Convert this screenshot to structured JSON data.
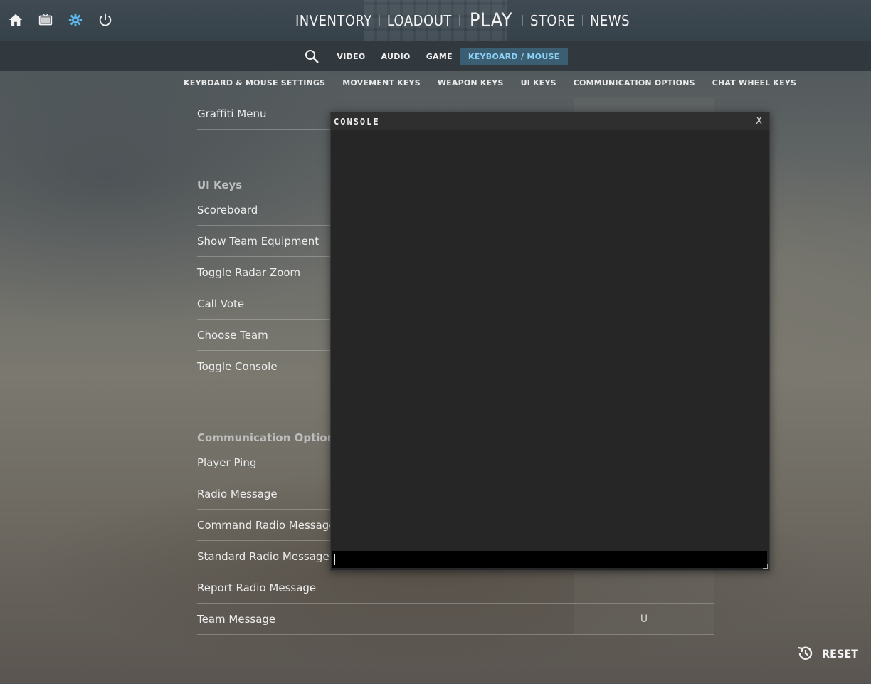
{
  "top_icons": [
    {
      "name": "home-icon"
    },
    {
      "name": "tv-icon"
    },
    {
      "name": "settings-icon"
    },
    {
      "name": "power-icon"
    }
  ],
  "main_nav": {
    "inventory": "INVENTORY",
    "loadout": "LOADOUT",
    "play": "PLAY",
    "store": "STORE",
    "news": "NEWS"
  },
  "settings_tabs": {
    "video": "VIDEO",
    "audio": "AUDIO",
    "game": "GAME",
    "keyboard_mouse": "KEYBOARD / MOUSE",
    "active": "KEYBOARD / MOUSE"
  },
  "categories": [
    "KEYBOARD & MOUSE SETTINGS",
    "MOVEMENT KEYS",
    "WEAPON KEYS",
    "UI KEYS",
    "COMMUNICATION OPTIONS",
    "CHAT WHEEL KEYS"
  ],
  "settings": {
    "top_row": {
      "label": "Graffiti Menu",
      "key": ""
    },
    "ui_keys_title": "UI Keys",
    "ui_keys": [
      {
        "label": "Scoreboard",
        "key": ""
      },
      {
        "label": "Show Team Equipment",
        "key": ""
      },
      {
        "label": "Toggle Radar Zoom",
        "key": ""
      },
      {
        "label": "Call Vote",
        "key": ""
      },
      {
        "label": "Choose Team",
        "key": ""
      },
      {
        "label": "Toggle Console",
        "key": ""
      }
    ],
    "comm_title": "Communication Options",
    "comm": [
      {
        "label": "Player Ping",
        "key": ""
      },
      {
        "label": "Radio Message",
        "key": ""
      },
      {
        "label": "Command Radio Message",
        "key": ""
      },
      {
        "label": "Standard Radio Message",
        "key": ""
      },
      {
        "label": "Report Radio Message",
        "key": ""
      },
      {
        "label": "Team Message",
        "key": "U"
      }
    ]
  },
  "console": {
    "title": "CONSOLE",
    "close": "X",
    "input_value": ""
  },
  "footer": {
    "reset_label": "RESET"
  },
  "colors": {
    "accent": "#8fd2f5",
    "active_tab_bg": "#3b5e73",
    "console_bg": "#262626"
  }
}
